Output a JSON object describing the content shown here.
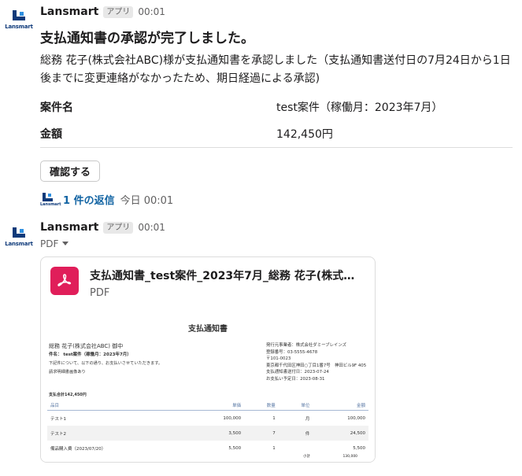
{
  "brand": {
    "logo_text": "Lansmart",
    "colors": {
      "navy": "#0e3a7a",
      "accent": "#2f8fe0",
      "link": "#1264a3",
      "pdf_red": "#e01e5a"
    }
  },
  "message1": {
    "sender": "Lansmart",
    "badge": "アプリ",
    "time": "00:01",
    "title": "支払通知書の承認が完了しました。",
    "body": "総務 花子(株式会社ABC)様が支払通知書を承認しました（支払通知書送付日の7月24日から1日後までに変更連絡がなかったため、期日経過による承認)",
    "fields": [
      {
        "label": "案件名",
        "value": "test案件（稼働月：2023年7月）"
      },
      {
        "label": "金額",
        "value": "142,450円"
      }
    ],
    "button_label": "確認する",
    "thread": {
      "reply_text": "1 件の返信",
      "reply_time": "今日 00:01"
    }
  },
  "message2": {
    "sender": "Lansmart",
    "badge": "アプリ",
    "time": "00:01",
    "toggle_label": "PDF",
    "file": {
      "name": "支払通知書_test案件_2023年7月_総務 花子(株式会社...",
      "type": "PDF",
      "preview": {
        "title": "支払通知書",
        "recipient": "総務 花子(株式会社ABC) 御中",
        "subject": "件名： test案件（稼働月：2023年7月）",
        "line1": "下記件について、以下の通り、お支払いさせていただきます。",
        "line2": "請求明細書画像あり",
        "sender_lines": [
          "発行元事業者：株式会社ダミーブレインズ",
          "登録番号：03-5555-4678",
          "〒101-0023",
          "東京都千代田区神田○丁目1番7号　神田ビル9F 405",
          "支払通知書送付日：2023-07-24",
          "お支払い予定日：2023-08-31"
        ],
        "total": "支払合計142,450円",
        "columns": [
          "品目",
          "単価",
          "数量",
          "単位",
          "金額"
        ],
        "rows": [
          [
            "テスト1",
            "100,000",
            "1",
            "月",
            "100,000"
          ],
          [
            "テスト2",
            "3,500",
            "7",
            "件",
            "24,500"
          ],
          [
            "備品購入費（2023/07/20）",
            "5,500",
            "1",
            "",
            "5,500"
          ]
        ],
        "subtotal_label": "小計",
        "subtotal_value": "130,000"
      }
    }
  }
}
